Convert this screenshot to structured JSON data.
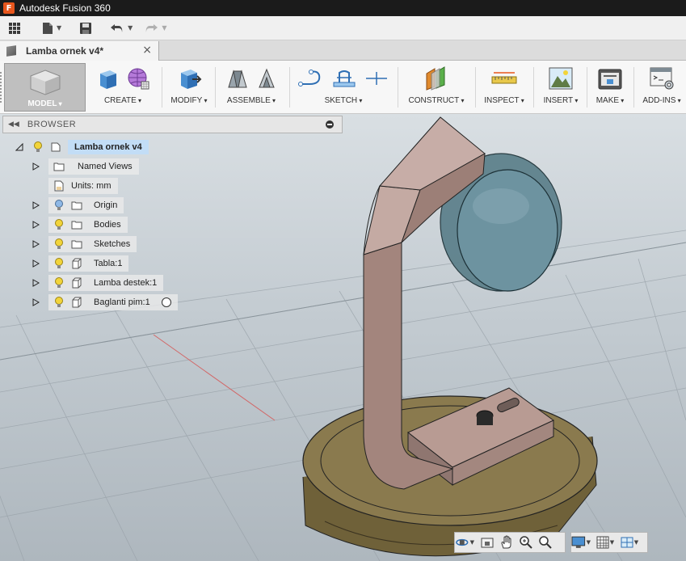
{
  "app": {
    "title": "Autodesk Fusion 360",
    "logo_letter": "F"
  },
  "document_tab": {
    "label": "Lamba ornek v4*",
    "close": "×"
  },
  "ribbon": {
    "groups": [
      {
        "label": "MODEL",
        "name": "model"
      },
      {
        "label": "CREATE",
        "name": "create"
      },
      {
        "label": "MODIFY",
        "name": "modify"
      },
      {
        "label": "ASSEMBLE",
        "name": "assemble"
      },
      {
        "label": "SKETCH",
        "name": "sketch"
      },
      {
        "label": "CONSTRUCT",
        "name": "construct"
      },
      {
        "label": "INSPECT",
        "name": "inspect"
      },
      {
        "label": "INSERT",
        "name": "insert"
      },
      {
        "label": "MAKE",
        "name": "make"
      },
      {
        "label": "ADD-INS",
        "name": "add-ins"
      }
    ]
  },
  "browser": {
    "title": "BROWSER",
    "root": "Lamba ornek v4",
    "items": [
      {
        "label": "Named Views",
        "icon": "folder-icon",
        "has_light": false
      },
      {
        "label": "Units: mm",
        "icon": "document-icon",
        "has_light": false
      },
      {
        "label": "Origin",
        "icon": "folder-icon",
        "has_light": true
      },
      {
        "label": "Bodies",
        "icon": "folder-icon",
        "has_light": true
      },
      {
        "label": "Sketches",
        "icon": "folder-icon",
        "has_light": true
      },
      {
        "label": "Tabla:1",
        "icon": "component-icon",
        "has_light": true
      },
      {
        "label": "Lamba destek:1",
        "icon": "component-icon",
        "has_light": true
      },
      {
        "label": "Baglanti pim:1",
        "icon": "component-icon",
        "has_light": true
      }
    ]
  },
  "colors": {
    "accent": "#e8561c",
    "selection": "#c2ddf6",
    "bulb_on": "#f2d43a",
    "bulb_origin": "#8fb8e6",
    "lamp_body": "#b89b93",
    "lamp_shade": "#5b7f8a",
    "base_wood": "#8a7a4e"
  }
}
